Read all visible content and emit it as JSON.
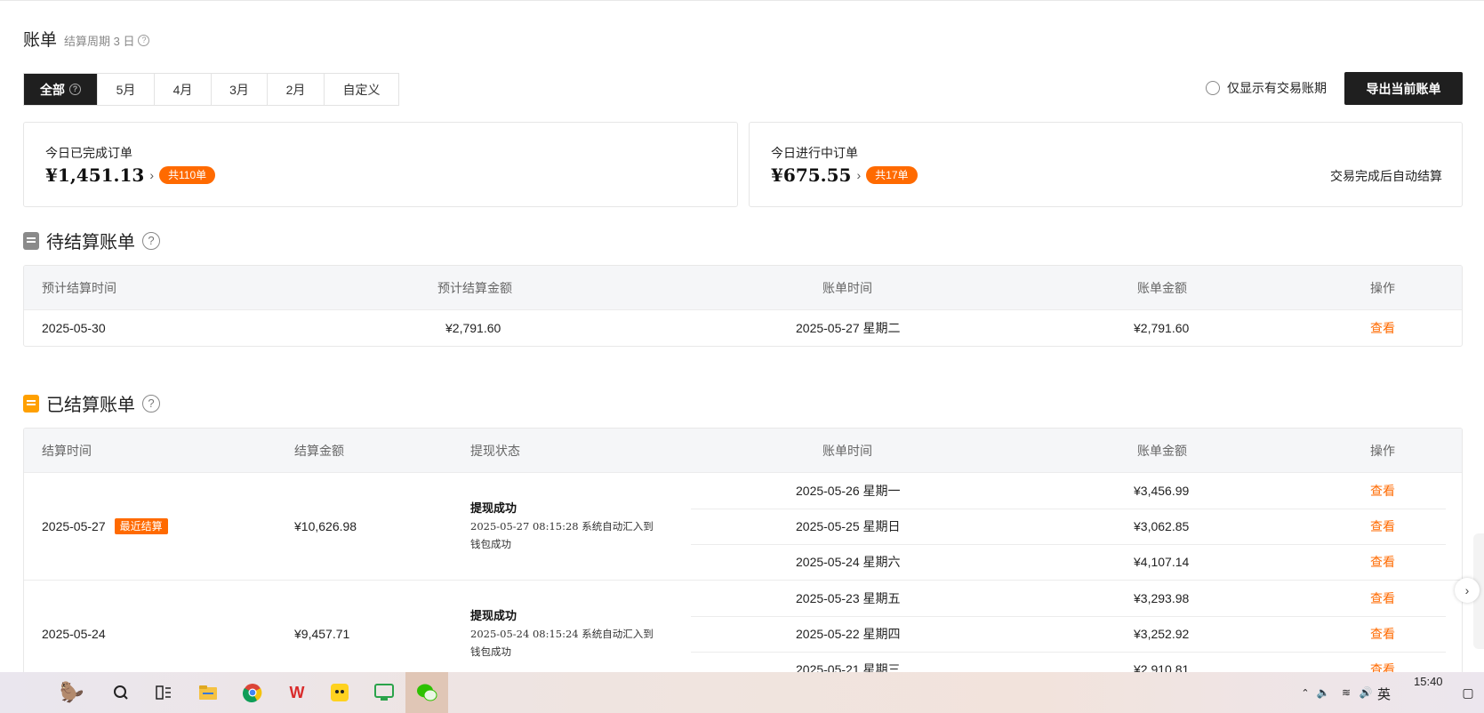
{
  "header": {
    "title": "账单",
    "cycle": "结算周期 3 日",
    "help": "?"
  },
  "tabs": [
    {
      "label": "全部",
      "active": true
    },
    {
      "label": "5月"
    },
    {
      "label": "4月"
    },
    {
      "label": "3月"
    },
    {
      "label": "2月"
    },
    {
      "label": "自定义"
    }
  ],
  "filter": {
    "label": "仅显示有交易账期",
    "checked": false
  },
  "export_label": "导出当前账单",
  "cards": {
    "completed": {
      "label": "今日已完成订单",
      "amount": "¥1,451.13",
      "arrow": "›",
      "count": "共110单"
    },
    "inprogress": {
      "label": "今日进行中订单",
      "amount": "¥675.55",
      "arrow": "›",
      "count": "共17单",
      "note": "交易完成后自动结算"
    }
  },
  "pending": {
    "title": "待结算账单",
    "columns": [
      "预计结算时间",
      "预计结算金额",
      "账单时间",
      "账单金额",
      "操作"
    ],
    "rows": [
      {
        "settle_time": "2025-05-30",
        "settle_amount": "¥2,791.60",
        "bill_time": "2025-05-27 星期二",
        "bill_amount": "¥2,791.60",
        "action": "查看"
      }
    ]
  },
  "settled": {
    "title": "已结算账单",
    "columns": [
      "结算时间",
      "结算金额",
      "提现状态",
      "账单时间",
      "账单金额",
      "操作"
    ],
    "groups": [
      {
        "settle_time": "2025-05-27",
        "badge": "最近结算",
        "amount": "¥10,626.98",
        "status_title": "提现成功",
        "status_detail": "2025-05-27 08:15:28 系统自动汇入到钱包成功",
        "bills": [
          {
            "time": "2025-05-26 星期一",
            "amount": "¥3,456.99",
            "action": "查看"
          },
          {
            "time": "2025-05-25 星期日",
            "amount": "¥3,062.85",
            "action": "查看"
          },
          {
            "time": "2025-05-24 星期六",
            "amount": "¥4,107.14",
            "action": "查看"
          }
        ]
      },
      {
        "settle_time": "2025-05-24",
        "amount": "¥9,457.71",
        "status_title": "提现成功",
        "status_detail": "2025-05-24 08:15:24 系统自动汇入到钱包成功",
        "bills": [
          {
            "time": "2025-05-23 星期五",
            "amount": "¥3,293.98",
            "action": "查看"
          },
          {
            "time": "2025-05-22 星期四",
            "amount": "¥3,252.92",
            "action": "查看"
          },
          {
            "time": "2025-05-21 星期三",
            "amount": "¥2,910.81",
            "action": "查看"
          }
        ]
      }
    ]
  },
  "taskbar": {
    "time": "15:40",
    "ime": "英"
  },
  "colors": {
    "accent": "#ff6a00",
    "dark": "#1f1f1f"
  }
}
